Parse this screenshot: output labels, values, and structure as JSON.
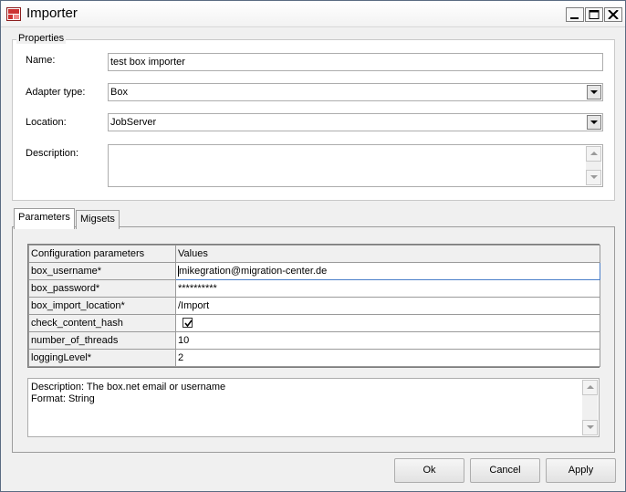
{
  "window": {
    "title": "Importer"
  },
  "properties": {
    "group_label": "Properties",
    "name_label": "Name:",
    "name_value": "test box importer",
    "adapter_label": "Adapter type:",
    "adapter_value": "Box",
    "location_label": "Location:",
    "location_value": "JobServer",
    "description_label": "Description:",
    "description_value": ""
  },
  "tabs": [
    {
      "label": "Parameters",
      "active": true
    },
    {
      "label": "Migsets",
      "active": false
    }
  ],
  "parameters": {
    "headers": [
      "Configuration parameters",
      "Values"
    ],
    "rows": [
      {
        "name": "box_username*",
        "value": "mikegration@migration-center.de"
      },
      {
        "name": "box_password*",
        "value": "**********"
      },
      {
        "name": "box_import_location*",
        "value": "/Import"
      },
      {
        "name": "check_content_hash",
        "value": "",
        "checked": true
      },
      {
        "name": "number_of_threads",
        "value": "10"
      },
      {
        "name": "loggingLevel*",
        "value": "2"
      }
    ]
  },
  "info": {
    "line1": "Description: The box.net email or username",
    "line2": "Format: String"
  },
  "buttons": {
    "ok": "Ok",
    "cancel": "Cancel",
    "apply": "Apply"
  }
}
